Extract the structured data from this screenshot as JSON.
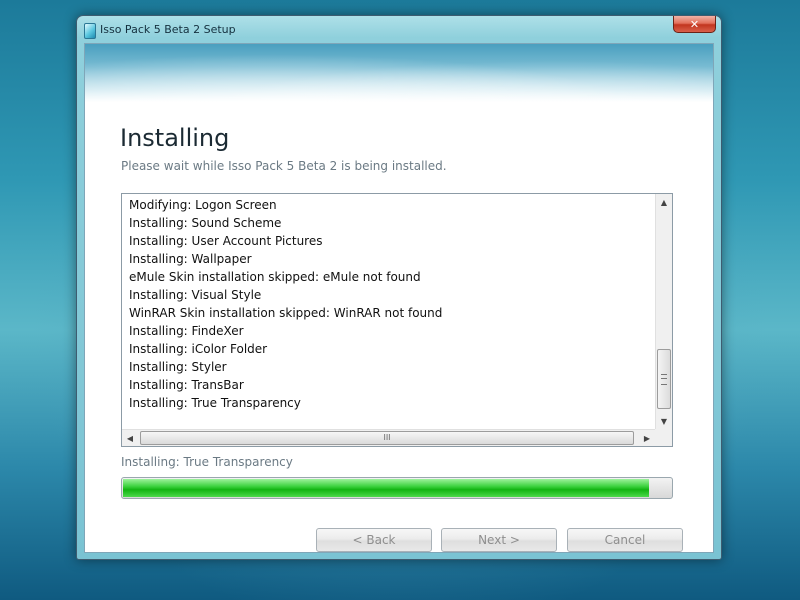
{
  "window": {
    "title": "Isso Pack 5 Beta 2 Setup",
    "close_symbol": "✕"
  },
  "header": {
    "title": "Installing",
    "subtitle": "Please wait while Isso Pack 5 Beta 2 is being installed."
  },
  "log": {
    "lines": [
      "Modifying: Logon Screen",
      "Installing: Sound Scheme",
      "Installing: User Account Pictures",
      "Installing: Wallpaper",
      "eMule Skin installation skipped: eMule not found",
      "Installing: Visual Style",
      "WinRAR Skin installation skipped: WinRAR not found",
      "Installing: FindeXer",
      "Installing: iColor Folder",
      "Installing: Styler",
      "Installing: TransBar",
      "Installing: True Transparency"
    ],
    "scroll_up": "▲",
    "scroll_down": "▼",
    "scroll_left": "◀",
    "scroll_right": "▶",
    "hgrip": "III"
  },
  "status": "Installing: True Transparency",
  "progress": {
    "percent": 96,
    "color": "#12b412"
  },
  "buttons": {
    "back": "< Back",
    "next": "Next >",
    "cancel": "Cancel"
  },
  "icons": {
    "app": "app-icon",
    "close": "close-icon"
  }
}
